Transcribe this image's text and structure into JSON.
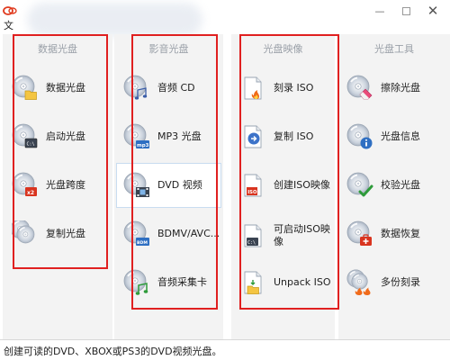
{
  "window": {
    "menu_file": "文",
    "min_glyph": "—",
    "close_glyph": "✕"
  },
  "columns": [
    {
      "header": "数据光盘",
      "items": [
        {
          "label": "数据光盘",
          "icon": "disc-folder-icon"
        },
        {
          "label": "启动光盘",
          "icon": "disc-boot-icon"
        },
        {
          "label": "光盘跨度",
          "icon": "disc-span-icon"
        },
        {
          "label": "复制光盘",
          "icon": "disc-copy-icon"
        }
      ]
    },
    {
      "header": "影音光盘",
      "items": [
        {
          "label": "音频 CD",
          "icon": "audio-cd-icon"
        },
        {
          "label": "MP3 光盘",
          "icon": "mp3-disc-icon"
        },
        {
          "label": "DVD 视频",
          "icon": "dvd-video-icon"
        },
        {
          "label": "BDMV/AVC...",
          "icon": "bdmv-icon"
        },
        {
          "label": "音频采集卡",
          "icon": "audio-grabber-icon"
        }
      ]
    },
    {
      "header": "光盘映像",
      "items": [
        {
          "label": "刻录 ISO",
          "icon": "burn-iso-icon"
        },
        {
          "label": "复制 ISO",
          "icon": "copy-iso-icon"
        },
        {
          "label": "创建ISO映像",
          "icon": "create-iso-icon"
        },
        {
          "label": "可启动ISO映像",
          "icon": "bootable-iso-icon"
        },
        {
          "label": "Unpack ISO",
          "icon": "unpack-iso-icon"
        }
      ]
    },
    {
      "header": "光盘工具",
      "items": [
        {
          "label": "擦除光盘",
          "icon": "erase-disc-icon"
        },
        {
          "label": "光盘信息",
          "icon": "disc-info-icon"
        },
        {
          "label": "校验光盘",
          "icon": "verify-disc-icon"
        },
        {
          "label": "数据恢复",
          "icon": "data-recovery-icon"
        },
        {
          "label": "多份刻录",
          "icon": "multi-burn-icon"
        }
      ]
    }
  ],
  "selected_item": "DVD 视频",
  "status": {
    "text": "创建可读的DVD、XBOX或PS3的DVD视频光盘。"
  },
  "colors": {
    "annotation_red": "#e02020",
    "column_bg": "#f3f3f3",
    "header_gray": "#9aa0a8"
  }
}
